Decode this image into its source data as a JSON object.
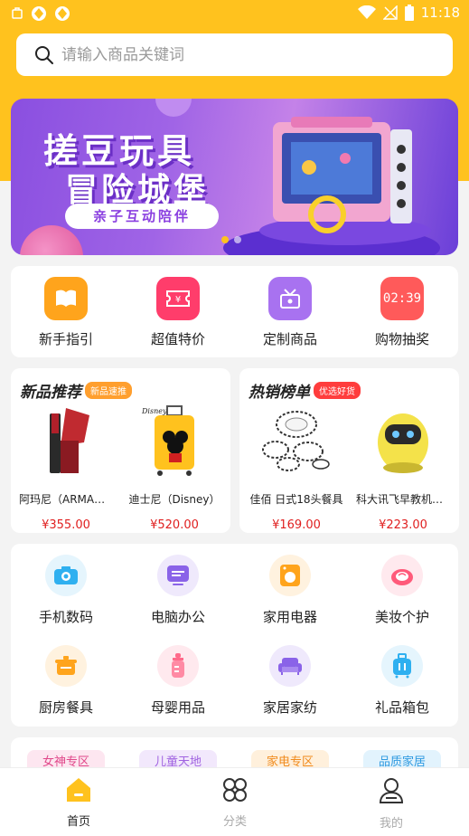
{
  "status": {
    "time": "11:18"
  },
  "search": {
    "placeholder": "请输入商品关键词"
  },
  "banner": {
    "title": "搓豆玩具",
    "subtitle": "冒险城堡",
    "tag": "亲子互动陪伴",
    "slides": 2,
    "active_slide": 1
  },
  "quick_links": [
    {
      "label": "新手指引",
      "icon": "book-icon",
      "color": "#ffa41c"
    },
    {
      "label": "超值特价",
      "icon": "ticket-icon",
      "color": "#ff3d6b"
    },
    {
      "label": "定制商品",
      "icon": "gift-box-icon",
      "color": "#a872f0"
    },
    {
      "label": "购物抽奖",
      "icon": "clock-icon",
      "color": "#ff5a5a",
      "clock_text": "02:39"
    }
  ],
  "new_products": {
    "title": "新品推荐",
    "badge": "新品速推",
    "badge_color": "#ff9f2e",
    "items": [
      {
        "name": "阿玛尼（ARMANI）",
        "price": "¥355.00",
        "image": "lipstick-image"
      },
      {
        "name": "迪士尼（Disney）",
        "price": "¥520.00",
        "image": "suitcase-image"
      }
    ]
  },
  "hot_products": {
    "title": "热销榜单",
    "badge": "优选好货",
    "badge_color": "#ff3d3d",
    "items": [
      {
        "name": "佳佰 日式18头餐具",
        "price": "¥169.00",
        "image": "tableware-image"
      },
      {
        "name": "科大讯飞早教机器人",
        "price": "¥223.00",
        "image": "robot-image"
      }
    ]
  },
  "categories": [
    {
      "label": "手机数码",
      "icon": "camera-icon",
      "color": "#2fb0f0",
      "bg": "#e5f5fd"
    },
    {
      "label": "电脑办公",
      "icon": "monitor-icon",
      "color": "#8a63e8",
      "bg": "#efe9fc"
    },
    {
      "label": "家用电器",
      "icon": "washer-icon",
      "color": "#ffa41c",
      "bg": "#fff2df"
    },
    {
      "label": "美妆个护",
      "icon": "compact-icon",
      "color": "#ff5a7a",
      "bg": "#ffe9ee"
    },
    {
      "label": "厨房餐具",
      "icon": "pot-icon",
      "color": "#ffa41c",
      "bg": "#fff2df"
    },
    {
      "label": "母婴用品",
      "icon": "bottle-icon",
      "color": "#ff6a8a",
      "bg": "#ffe9ee"
    },
    {
      "label": "家居家纺",
      "icon": "sofa-icon",
      "color": "#8a63e8",
      "bg": "#efe9fc"
    },
    {
      "label": "礼品箱包",
      "icon": "luggage-icon",
      "color": "#2fb0f0",
      "bg": "#e5f5fd"
    }
  ],
  "zones": [
    {
      "label": "女神专区",
      "color": "#e0488a",
      "bg": "#fde6f0"
    },
    {
      "label": "儿童天地",
      "color": "#a062e0",
      "bg": "#f2e8fc"
    },
    {
      "label": "家电专区",
      "color": "#f08a1c",
      "bg": "#fff0dc"
    },
    {
      "label": "品质家居",
      "color": "#2f9ae0",
      "bg": "#e2f3fd"
    }
  ],
  "tabs": [
    {
      "label": "首页",
      "icon": "home-icon",
      "active": true
    },
    {
      "label": "分类",
      "icon": "category-icon",
      "active": false
    },
    {
      "label": "我的",
      "icon": "profile-icon",
      "active": false
    }
  ]
}
